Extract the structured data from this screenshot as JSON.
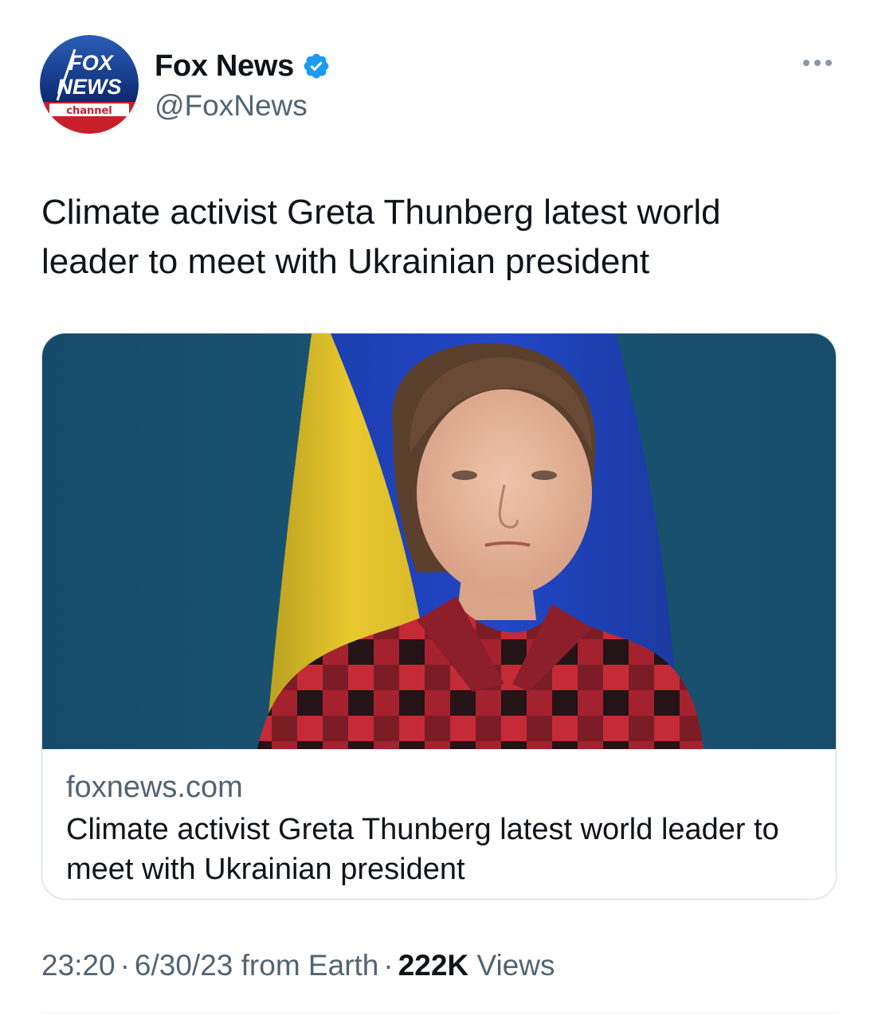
{
  "author": {
    "display_name": "Fox News",
    "handle": "@FoxNews",
    "verified": true,
    "avatar_logo_lines": [
      "FOX",
      "NEWS",
      "channel"
    ]
  },
  "tweet": {
    "text": "Climate activist Greta Thunberg latest world leader to meet with Ukrainian president"
  },
  "card": {
    "domain": "foxnews.com",
    "title": "Climate activist Greta Thunberg latest world leader to meet with Ukrainian president"
  },
  "footer": {
    "time": "23:20",
    "date": "6/30/23",
    "source": "from Earth",
    "separator": "·",
    "views_count": "222K",
    "views_label": "Views"
  },
  "icons": {
    "verified": "verified-badge-icon",
    "more": "more-options-icon"
  },
  "colors": {
    "text_primary": "#0f1419",
    "text_secondary": "#536471",
    "verified_blue": "#1d9bf0",
    "border": "#cfd9de"
  }
}
